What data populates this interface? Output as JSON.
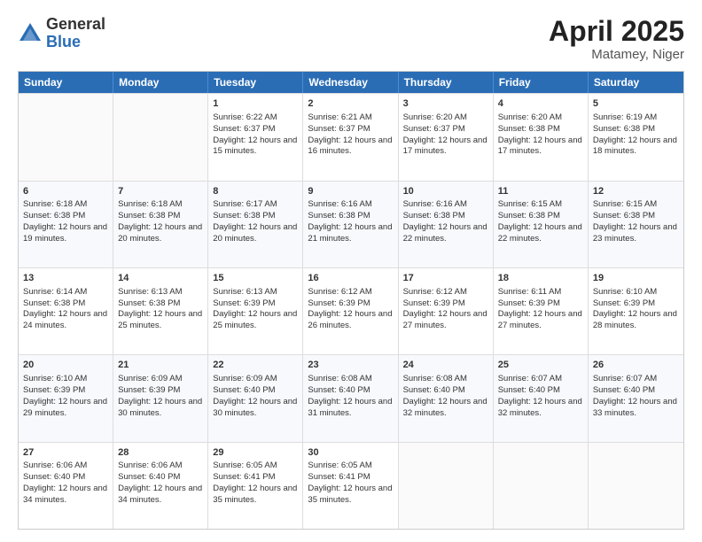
{
  "logo": {
    "general": "General",
    "blue": "Blue"
  },
  "title": "April 2025",
  "location": "Matamey, Niger",
  "header_days": [
    "Sunday",
    "Monday",
    "Tuesday",
    "Wednesday",
    "Thursday",
    "Friday",
    "Saturday"
  ],
  "weeks": [
    [
      {
        "day": "",
        "sunrise": "",
        "sunset": "",
        "daylight": ""
      },
      {
        "day": "",
        "sunrise": "",
        "sunset": "",
        "daylight": ""
      },
      {
        "day": "1",
        "sunrise": "Sunrise: 6:22 AM",
        "sunset": "Sunset: 6:37 PM",
        "daylight": "Daylight: 12 hours and 15 minutes."
      },
      {
        "day": "2",
        "sunrise": "Sunrise: 6:21 AM",
        "sunset": "Sunset: 6:37 PM",
        "daylight": "Daylight: 12 hours and 16 minutes."
      },
      {
        "day": "3",
        "sunrise": "Sunrise: 6:20 AM",
        "sunset": "Sunset: 6:37 PM",
        "daylight": "Daylight: 12 hours and 17 minutes."
      },
      {
        "day": "4",
        "sunrise": "Sunrise: 6:20 AM",
        "sunset": "Sunset: 6:38 PM",
        "daylight": "Daylight: 12 hours and 17 minutes."
      },
      {
        "day": "5",
        "sunrise": "Sunrise: 6:19 AM",
        "sunset": "Sunset: 6:38 PM",
        "daylight": "Daylight: 12 hours and 18 minutes."
      }
    ],
    [
      {
        "day": "6",
        "sunrise": "Sunrise: 6:18 AM",
        "sunset": "Sunset: 6:38 PM",
        "daylight": "Daylight: 12 hours and 19 minutes."
      },
      {
        "day": "7",
        "sunrise": "Sunrise: 6:18 AM",
        "sunset": "Sunset: 6:38 PM",
        "daylight": "Daylight: 12 hours and 20 minutes."
      },
      {
        "day": "8",
        "sunrise": "Sunrise: 6:17 AM",
        "sunset": "Sunset: 6:38 PM",
        "daylight": "Daylight: 12 hours and 20 minutes."
      },
      {
        "day": "9",
        "sunrise": "Sunrise: 6:16 AM",
        "sunset": "Sunset: 6:38 PM",
        "daylight": "Daylight: 12 hours and 21 minutes."
      },
      {
        "day": "10",
        "sunrise": "Sunrise: 6:16 AM",
        "sunset": "Sunset: 6:38 PM",
        "daylight": "Daylight: 12 hours and 22 minutes."
      },
      {
        "day": "11",
        "sunrise": "Sunrise: 6:15 AM",
        "sunset": "Sunset: 6:38 PM",
        "daylight": "Daylight: 12 hours and 22 minutes."
      },
      {
        "day": "12",
        "sunrise": "Sunrise: 6:15 AM",
        "sunset": "Sunset: 6:38 PM",
        "daylight": "Daylight: 12 hours and 23 minutes."
      }
    ],
    [
      {
        "day": "13",
        "sunrise": "Sunrise: 6:14 AM",
        "sunset": "Sunset: 6:38 PM",
        "daylight": "Daylight: 12 hours and 24 minutes."
      },
      {
        "day": "14",
        "sunrise": "Sunrise: 6:13 AM",
        "sunset": "Sunset: 6:38 PM",
        "daylight": "Daylight: 12 hours and 25 minutes."
      },
      {
        "day": "15",
        "sunrise": "Sunrise: 6:13 AM",
        "sunset": "Sunset: 6:39 PM",
        "daylight": "Daylight: 12 hours and 25 minutes."
      },
      {
        "day": "16",
        "sunrise": "Sunrise: 6:12 AM",
        "sunset": "Sunset: 6:39 PM",
        "daylight": "Daylight: 12 hours and 26 minutes."
      },
      {
        "day": "17",
        "sunrise": "Sunrise: 6:12 AM",
        "sunset": "Sunset: 6:39 PM",
        "daylight": "Daylight: 12 hours and 27 minutes."
      },
      {
        "day": "18",
        "sunrise": "Sunrise: 6:11 AM",
        "sunset": "Sunset: 6:39 PM",
        "daylight": "Daylight: 12 hours and 27 minutes."
      },
      {
        "day": "19",
        "sunrise": "Sunrise: 6:10 AM",
        "sunset": "Sunset: 6:39 PM",
        "daylight": "Daylight: 12 hours and 28 minutes."
      }
    ],
    [
      {
        "day": "20",
        "sunrise": "Sunrise: 6:10 AM",
        "sunset": "Sunset: 6:39 PM",
        "daylight": "Daylight: 12 hours and 29 minutes."
      },
      {
        "day": "21",
        "sunrise": "Sunrise: 6:09 AM",
        "sunset": "Sunset: 6:39 PM",
        "daylight": "Daylight: 12 hours and 30 minutes."
      },
      {
        "day": "22",
        "sunrise": "Sunrise: 6:09 AM",
        "sunset": "Sunset: 6:40 PM",
        "daylight": "Daylight: 12 hours and 30 minutes."
      },
      {
        "day": "23",
        "sunrise": "Sunrise: 6:08 AM",
        "sunset": "Sunset: 6:40 PM",
        "daylight": "Daylight: 12 hours and 31 minutes."
      },
      {
        "day": "24",
        "sunrise": "Sunrise: 6:08 AM",
        "sunset": "Sunset: 6:40 PM",
        "daylight": "Daylight: 12 hours and 32 minutes."
      },
      {
        "day": "25",
        "sunrise": "Sunrise: 6:07 AM",
        "sunset": "Sunset: 6:40 PM",
        "daylight": "Daylight: 12 hours and 32 minutes."
      },
      {
        "day": "26",
        "sunrise": "Sunrise: 6:07 AM",
        "sunset": "Sunset: 6:40 PM",
        "daylight": "Daylight: 12 hours and 33 minutes."
      }
    ],
    [
      {
        "day": "27",
        "sunrise": "Sunrise: 6:06 AM",
        "sunset": "Sunset: 6:40 PM",
        "daylight": "Daylight: 12 hours and 34 minutes."
      },
      {
        "day": "28",
        "sunrise": "Sunrise: 6:06 AM",
        "sunset": "Sunset: 6:40 PM",
        "daylight": "Daylight: 12 hours and 34 minutes."
      },
      {
        "day": "29",
        "sunrise": "Sunrise: 6:05 AM",
        "sunset": "Sunset: 6:41 PM",
        "daylight": "Daylight: 12 hours and 35 minutes."
      },
      {
        "day": "30",
        "sunrise": "Sunrise: 6:05 AM",
        "sunset": "Sunset: 6:41 PM",
        "daylight": "Daylight: 12 hours and 35 minutes."
      },
      {
        "day": "",
        "sunrise": "",
        "sunset": "",
        "daylight": ""
      },
      {
        "day": "",
        "sunrise": "",
        "sunset": "",
        "daylight": ""
      },
      {
        "day": "",
        "sunrise": "",
        "sunset": "",
        "daylight": ""
      }
    ]
  ]
}
